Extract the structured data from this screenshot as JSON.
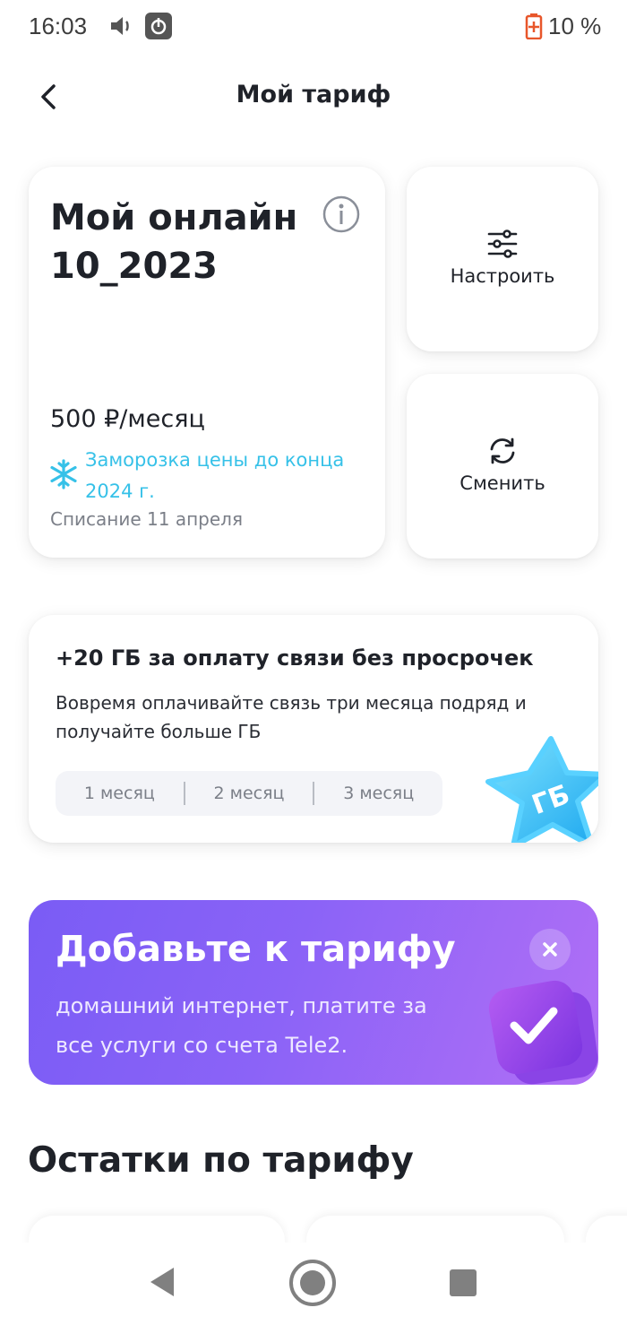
{
  "status_bar": {
    "time": "16:03",
    "battery": "10 %"
  },
  "header": {
    "title": "Мой тариф"
  },
  "plan": {
    "name_line1": "Мой онлайн",
    "name_line2": "10_2023",
    "price": "500 ₽/месяц",
    "freeze_line1": "Заморозка цены до конца",
    "freeze_line2": "2024 г.",
    "charge": "Списание 11 апреля"
  },
  "actions": {
    "configure": "Настроить",
    "change": "Сменить"
  },
  "promo": {
    "title": "+20 ГБ за оплату связи без просрочек",
    "text_line1": "Вовремя оплачивайте связь три месяца подряд и",
    "text_line2": "получайте больше ГБ",
    "months": [
      "1 месяц",
      "2 месяц",
      "3 месяц"
    ],
    "badge": "ГБ"
  },
  "addon": {
    "title": "Добавьте к тарифу",
    "text_line1": "домашний интернет, платите за",
    "text_line2": "все услуги со счета Tele2."
  },
  "remains": {
    "title": "Остатки по тарифу"
  },
  "colors": {
    "accent_cyan": "#36c1e8",
    "purple_start": "#7a5cf5",
    "purple_end": "#b16ff6"
  }
}
